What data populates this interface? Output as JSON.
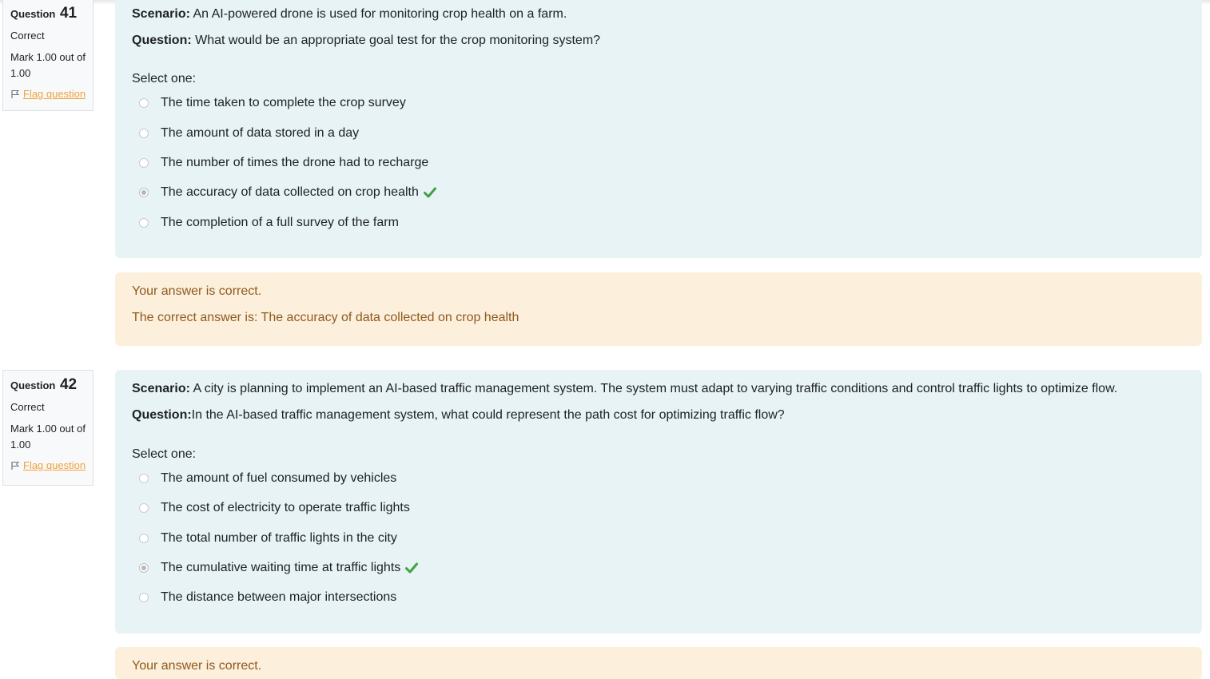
{
  "questions": [
    {
      "label": "Question",
      "number": "41",
      "state": "Correct",
      "grade": "Mark 1.00 out of 1.00",
      "flag_label": "Flag question",
      "scenario_label": "Scenario:",
      "scenario_text": " An AI-powered drone is used for monitoring crop health on a farm.",
      "question_label": "Question:",
      "question_text": " What would be an appropriate goal test for the crop monitoring system?",
      "prompt": "Select one:",
      "answers": [
        {
          "label": "The time taken to complete the crop survey",
          "selected": false
        },
        {
          "label": "The amount of data stored in a day",
          "selected": false
        },
        {
          "label": "The number of times the drone had to recharge",
          "selected": false
        },
        {
          "label": "The accuracy of data collected on crop health",
          "selected": true
        },
        {
          "label": "The completion of a full survey of the farm",
          "selected": false
        }
      ],
      "feedback_correct": "Your answer is correct.",
      "feedback_right_answer": "The correct answer is: The accuracy of data collected on crop health"
    },
    {
      "label": "Question",
      "number": "42",
      "state": "Correct",
      "grade": "Mark 1.00 out of 1.00",
      "flag_label": "Flag question",
      "scenario_label": "Scenario:",
      "scenario_text": " A city is planning to implement an AI-based traffic management system. The system must adapt to varying traffic conditions and control traffic lights to optimize flow.",
      "question_label": "Question:",
      "question_text": "In the AI-based traffic management system, what could represent the path cost for optimizing traffic flow?",
      "prompt": "Select one:",
      "answers": [
        {
          "label": "The amount of fuel consumed by vehicles",
          "selected": false
        },
        {
          "label": "The cost of electricity to operate traffic lights",
          "selected": false
        },
        {
          "label": "The total number of traffic lights in the city",
          "selected": false
        },
        {
          "label": "The cumulative waiting time at traffic lights",
          "selected": true
        },
        {
          "label": "The distance between major intersections",
          "selected": false
        }
      ],
      "feedback_correct": "Your answer is correct."
    }
  ],
  "icons": {
    "flag": "flag-icon",
    "check": "checkmark-icon",
    "radio": "radio-button"
  },
  "colors": {
    "formulation_bg": "#e7f3f5",
    "feedback_bg": "#fcefdc",
    "feedback_text": "#8e5a1d",
    "flag_link": "#f0a23a",
    "correct_check": "#43a047"
  }
}
